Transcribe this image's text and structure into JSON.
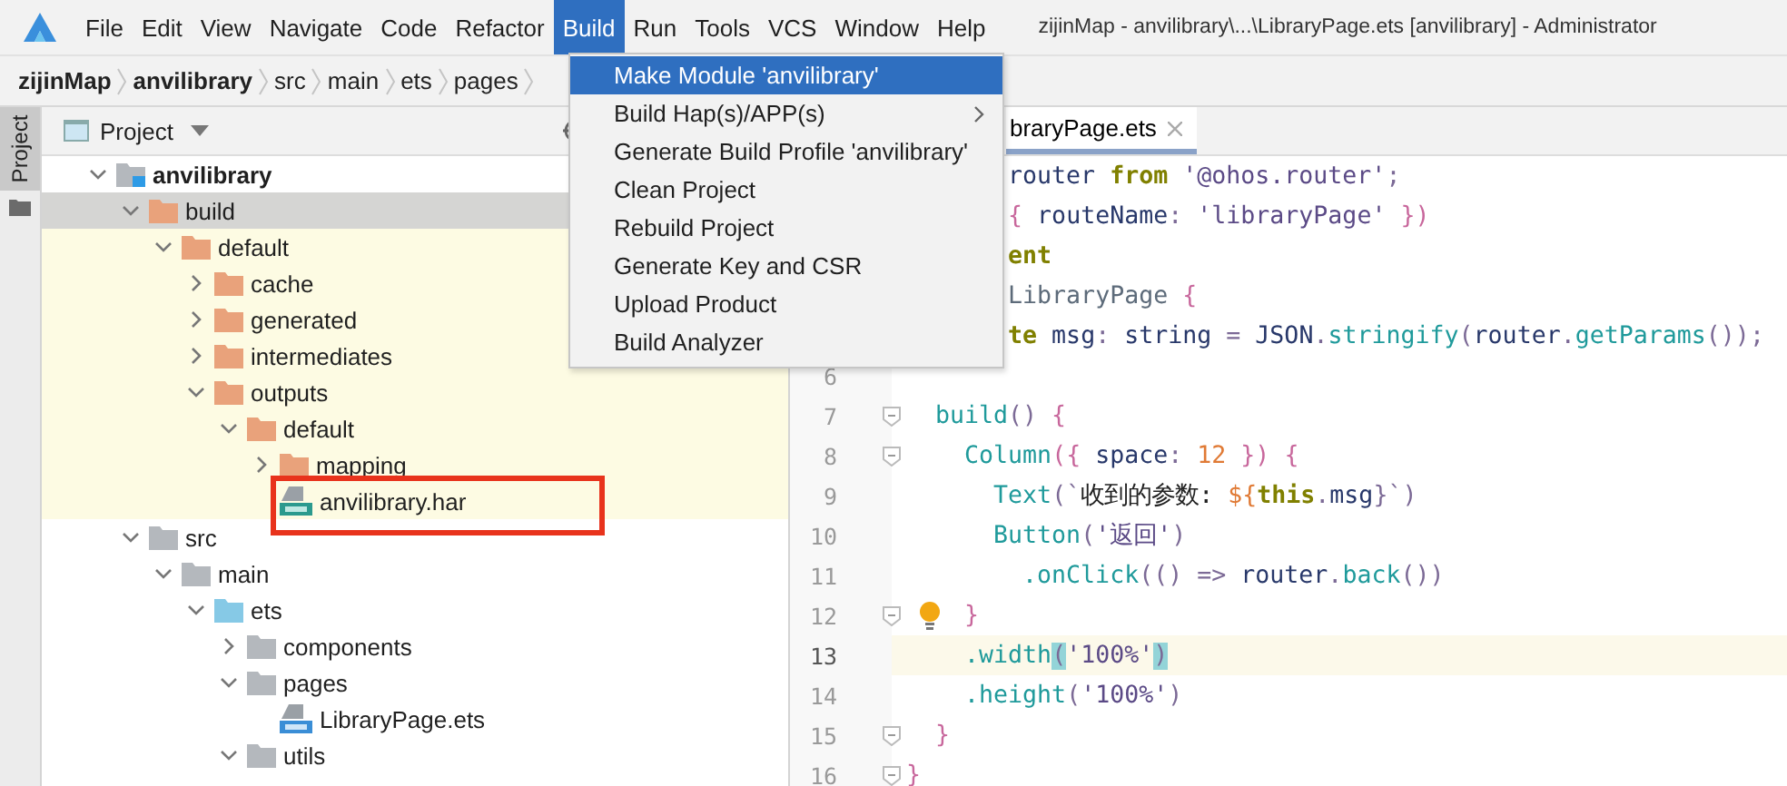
{
  "window": {
    "title": "zijinMap - anvilibrary\\...\\LibraryPage.ets [anvilibrary] - Administrator"
  },
  "menubar": {
    "items": [
      {
        "label": "File",
        "selected": false
      },
      {
        "label": "Edit",
        "selected": false
      },
      {
        "label": "View",
        "selected": false
      },
      {
        "label": "Navigate",
        "selected": false
      },
      {
        "label": "Code",
        "selected": false
      },
      {
        "label": "Refactor",
        "selected": false
      },
      {
        "label": "Build",
        "selected": true
      },
      {
        "label": "Run",
        "selected": false
      },
      {
        "label": "Tools",
        "selected": false
      },
      {
        "label": "VCS",
        "selected": false
      },
      {
        "label": "Window",
        "selected": false
      },
      {
        "label": "Help",
        "selected": false
      }
    ]
  },
  "breadcrumbs": [
    {
      "label": "zijinMap",
      "bold": true
    },
    {
      "label": "anvilibrary",
      "bold": true
    },
    {
      "label": "src",
      "bold": false
    },
    {
      "label": "main",
      "bold": false
    },
    {
      "label": "ets",
      "bold": false
    },
    {
      "label": "pages",
      "bold": false
    }
  ],
  "side_tabs": [
    {
      "label": "Project",
      "selected": true
    }
  ],
  "project": {
    "title": "Project",
    "tree": [
      {
        "label": "anvilibrary",
        "kind": "module",
        "expanded": true,
        "selected": false,
        "excluded": false,
        "boxed": false,
        "children": [
          {
            "label": "build",
            "kind": "folder",
            "color": "#e9a27b",
            "expanded": true,
            "selected": true,
            "excluded": true,
            "boxed": false,
            "children": [
              {
                "label": "default",
                "kind": "folder",
                "color": "#e9a27b",
                "expanded": true,
                "selected": false,
                "excluded": true,
                "boxed": false,
                "children": [
                  {
                    "label": "cache",
                    "kind": "folder",
                    "color": "#e9a27b",
                    "expanded": false,
                    "selected": false,
                    "excluded": true,
                    "boxed": false
                  },
                  {
                    "label": "generated",
                    "kind": "folder",
                    "color": "#e9a27b",
                    "expanded": false,
                    "selected": false,
                    "excluded": true,
                    "boxed": false
                  },
                  {
                    "label": "intermediates",
                    "kind": "folder",
                    "color": "#e9a27b",
                    "expanded": false,
                    "selected": false,
                    "excluded": true,
                    "boxed": false
                  },
                  {
                    "label": "outputs",
                    "kind": "folder",
                    "color": "#e9a27b",
                    "expanded": true,
                    "selected": false,
                    "excluded": true,
                    "boxed": false,
                    "children": [
                      {
                        "label": "default",
                        "kind": "folder",
                        "color": "#e9a27b",
                        "expanded": true,
                        "selected": false,
                        "excluded": true,
                        "boxed": false,
                        "children": [
                          {
                            "label": "mapping",
                            "kind": "folder",
                            "color": "#e9a27b",
                            "expanded": false,
                            "selected": false,
                            "excluded": true,
                            "boxed": false
                          },
                          {
                            "label": "anvilibrary.har",
                            "kind": "har",
                            "selected": false,
                            "excluded": true,
                            "boxed": true
                          }
                        ]
                      }
                    ]
                  }
                ]
              }
            ]
          },
          {
            "label": "src",
            "kind": "folder",
            "color": "#b4b8bd",
            "expanded": true,
            "selected": false,
            "excluded": false,
            "boxed": false,
            "children": [
              {
                "label": "main",
                "kind": "folder",
                "color": "#b4b8bd",
                "expanded": true,
                "selected": false,
                "excluded": false,
                "boxed": false,
                "children": [
                  {
                    "label": "ets",
                    "kind": "folder",
                    "color": "#86c9e6",
                    "expanded": true,
                    "selected": false,
                    "excluded": false,
                    "boxed": false,
                    "children": [
                      {
                        "label": "components",
                        "kind": "folder",
                        "color": "#b4b8bd",
                        "expanded": false,
                        "selected": false,
                        "excluded": false,
                        "boxed": false
                      },
                      {
                        "label": "pages",
                        "kind": "folder",
                        "color": "#b4b8bd",
                        "expanded": true,
                        "selected": false,
                        "excluded": false,
                        "boxed": false,
                        "children": [
                          {
                            "label": "LibraryPage.ets",
                            "kind": "ets",
                            "selected": false,
                            "excluded": false,
                            "boxed": false
                          }
                        ]
                      },
                      {
                        "label": "utils",
                        "kind": "folder",
                        "color": "#b4b8bd",
                        "expanded": true,
                        "selected": false,
                        "excluded": false,
                        "boxed": false
                      }
                    ]
                  }
                ]
              }
            ]
          }
        ]
      }
    ]
  },
  "editor": {
    "tab": {
      "label": "braryPage.ets",
      "selected": true
    },
    "lines": [
      {
        "fold": false,
        "bulb": false,
        "current": false,
        "tokens": [
          {
            "text": "       router",
            "kind": "id"
          },
          {
            "text": " from",
            "kind": "kw"
          },
          {
            "text": " '@ohos.router'",
            "kind": "str"
          },
          {
            "text": ";",
            "kind": "punc"
          }
        ]
      },
      {
        "fold": false,
        "bulb": false,
        "current": false,
        "tokens": [
          {
            "text": "       {",
            "kind": "brace"
          },
          {
            "text": " routeName",
            "kind": "id"
          },
          {
            "text": ":",
            "kind": "punc"
          },
          {
            "text": " 'libraryPage'",
            "kind": "str"
          },
          {
            "text": " })",
            "kind": "brace"
          }
        ]
      },
      {
        "fold": false,
        "bulb": false,
        "current": false,
        "tokens": [
          {
            "text": "       ent",
            "kind": "kw"
          }
        ]
      },
      {
        "fold": false,
        "bulb": false,
        "current": false,
        "tokens": [
          {
            "text": "       LibraryPage",
            "kind": "type"
          },
          {
            "text": " {",
            "kind": "brace"
          }
        ]
      },
      {
        "fold": false,
        "bulb": false,
        "current": false,
        "tokens": [
          {
            "text": "       te",
            "kind": "kw"
          },
          {
            "text": " msg",
            "kind": "id"
          },
          {
            "text": ": ",
            "kind": "punc"
          },
          {
            "text": "string",
            "kind": "id"
          },
          {
            "text": " = ",
            "kind": "punc"
          },
          {
            "text": "JSON",
            "kind": "id"
          },
          {
            "text": ".",
            "kind": "punc"
          },
          {
            "text": "stringify",
            "kind": "fn"
          },
          {
            "text": "(",
            "kind": "punc"
          },
          {
            "text": "router",
            "kind": "id"
          },
          {
            "text": ".",
            "kind": "punc"
          },
          {
            "text": "getParams",
            "kind": "fn"
          },
          {
            "text": "());",
            "kind": "punc"
          }
        ]
      },
      {
        "number": "6",
        "fold": false,
        "bulb": false,
        "current": false
      },
      {
        "number": "7",
        "fold": true,
        "bulb": false,
        "current": false,
        "tokens": [
          {
            "text": "  build",
            "kind": "fn"
          },
          {
            "text": "()",
            "kind": "punc"
          },
          {
            "text": " {",
            "kind": "brace"
          }
        ]
      },
      {
        "number": "8",
        "fold": true,
        "bulb": false,
        "current": false,
        "tokens": [
          {
            "text": "    Column",
            "kind": "fn"
          },
          {
            "text": "({",
            "kind": "brace"
          },
          {
            "text": " space",
            "kind": "id"
          },
          {
            "text": ": ",
            "kind": "punc"
          },
          {
            "text": "12",
            "kind": "num"
          },
          {
            "text": " })",
            "kind": "brace"
          },
          {
            "text": " {",
            "kind": "brace"
          }
        ]
      },
      {
        "number": "9",
        "fold": false,
        "bulb": false,
        "current": false,
        "tokens": [
          {
            "text": "      Text",
            "kind": "fn"
          },
          {
            "text": "(`",
            "kind": "punc"
          },
          {
            "text": "收到的参数: ",
            "kind": "plain"
          },
          {
            "text": "${",
            "kind": "num"
          },
          {
            "text": "this",
            "kind": "kw"
          },
          {
            "text": ".",
            "kind": "punc"
          },
          {
            "text": "msg",
            "kind": "id"
          },
          {
            "text": "}`)",
            "kind": "punc"
          }
        ]
      },
      {
        "number": "10",
        "fold": false,
        "bulb": false,
        "current": false,
        "tokens": [
          {
            "text": "      Button",
            "kind": "fn"
          },
          {
            "text": "(",
            "kind": "punc"
          },
          {
            "text": "'返回'",
            "kind": "str"
          },
          {
            "text": ")",
            "kind": "punc"
          }
        ]
      },
      {
        "number": "11",
        "fold": false,
        "bulb": false,
        "current": false,
        "tokens": [
          {
            "text": "        .onClick",
            "kind": "fn"
          },
          {
            "text": "(() =>",
            "kind": "punc"
          },
          {
            "text": " router",
            "kind": "id"
          },
          {
            "text": ".",
            "kind": "punc"
          },
          {
            "text": "back",
            "kind": "fn"
          },
          {
            "text": "())",
            "kind": "punc"
          }
        ]
      },
      {
        "number": "12",
        "fold": true,
        "bulb": true,
        "current": false,
        "tokens": [
          {
            "text": "    }",
            "kind": "brace"
          }
        ]
      },
      {
        "number": "13",
        "fold": false,
        "bulb": false,
        "current": true,
        "tokens": [
          {
            "text": "    .width",
            "kind": "fn"
          },
          {
            "text": "(",
            "kind": "match"
          },
          {
            "text": "'100%'",
            "kind": "str"
          },
          {
            "text": ")",
            "kind": "match"
          }
        ]
      },
      {
        "number": "14",
        "fold": false,
        "bulb": false,
        "current": false,
        "tokens": [
          {
            "text": "    .height",
            "kind": "fn"
          },
          {
            "text": "(",
            "kind": "punc"
          },
          {
            "text": "'100%'",
            "kind": "str"
          },
          {
            "text": ")",
            "kind": "punc"
          }
        ]
      },
      {
        "number": "15",
        "fold": true,
        "bulb": false,
        "current": false,
        "tokens": [
          {
            "text": "  }",
            "kind": "brace"
          }
        ]
      },
      {
        "number": "16",
        "fold": true,
        "bulb": false,
        "current": false,
        "tokens": [
          {
            "text": "}",
            "kind": "brace"
          }
        ]
      }
    ]
  },
  "build_menu": {
    "items": [
      {
        "label": "Make Module 'anvilibrary'",
        "kind": "action",
        "selected": true
      },
      {
        "label": "Build Hap(s)/APP(s)",
        "kind": "submenu",
        "selected": false
      },
      {
        "label": "Generate Build Profile 'anvilibrary'",
        "kind": "action",
        "selected": false
      },
      {
        "label": "Clean Project",
        "kind": "action",
        "selected": false
      },
      {
        "label": "Rebuild Project",
        "kind": "action",
        "selected": false
      },
      {
        "label": "Generate Key and CSR",
        "kind": "action",
        "selected": false
      },
      {
        "label": "Upload Product",
        "kind": "action",
        "selected": false
      },
      {
        "label": "Build Analyzer",
        "kind": "action",
        "selected": false
      }
    ]
  }
}
